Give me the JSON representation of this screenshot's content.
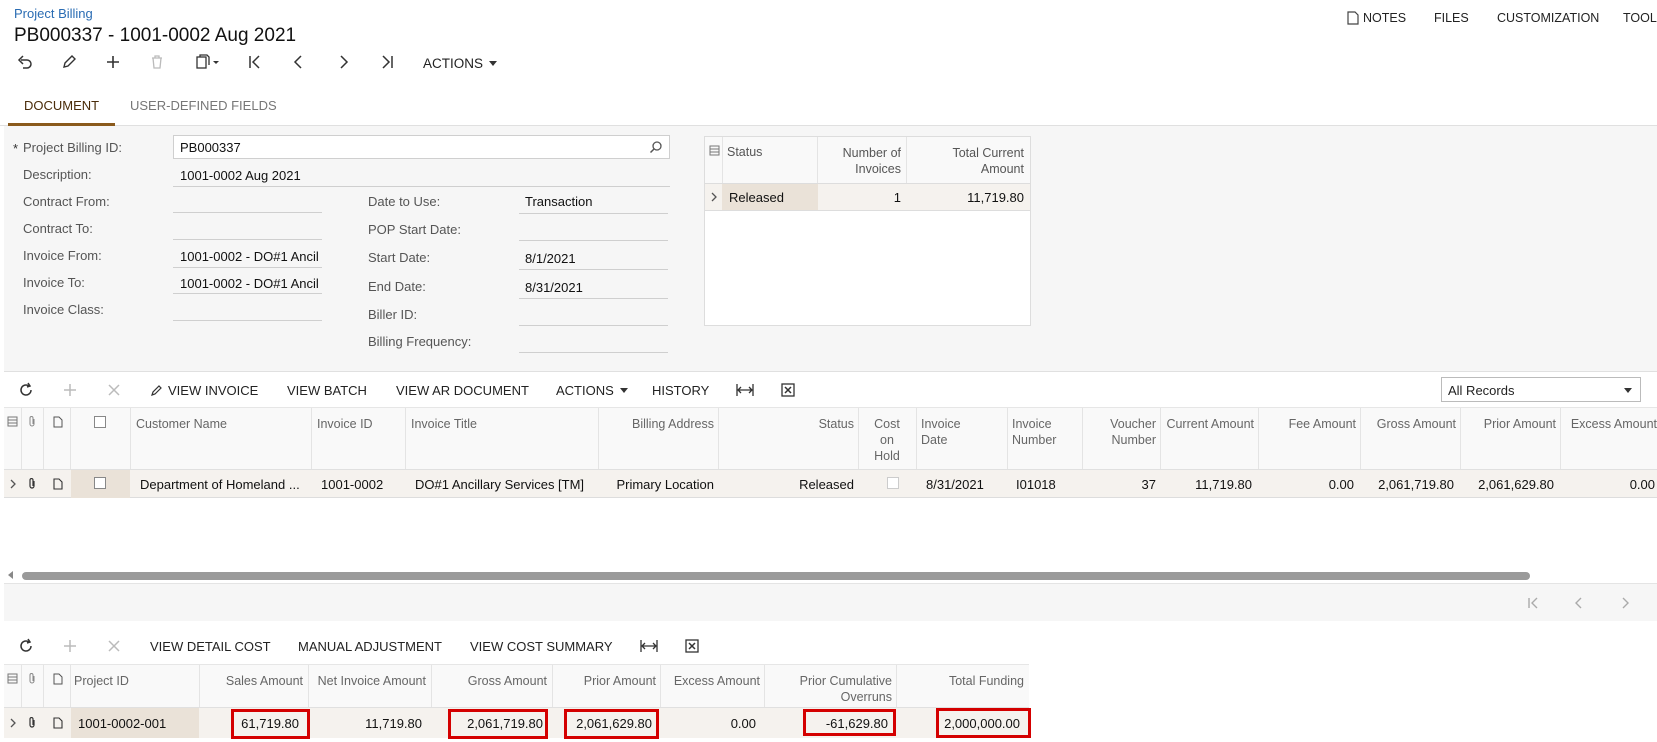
{
  "header": {
    "breadcrumb": "Project Billing",
    "title": "PB000337 - 1001-0002 Aug 2021",
    "right_menu": [
      "NOTES",
      "FILES",
      "CUSTOMIZATION",
      "TOOL"
    ],
    "actions_label": "ACTIONS"
  },
  "tabs": [
    "DOCUMENT",
    "USER-DEFINED FIELDS"
  ],
  "form": {
    "left": [
      {
        "label": "Project Billing ID:",
        "value": "PB000337"
      },
      {
        "label": "Description:",
        "value": "1001-0002 Aug 2021"
      },
      {
        "label": "Contract From:",
        "value": ""
      },
      {
        "label": "Contract To:",
        "value": ""
      },
      {
        "label": "Invoice From:",
        "value": "1001-0002 - DO#1 Ancil"
      },
      {
        "label": "Invoice To:",
        "value": "1001-0002 - DO#1 Ancil"
      },
      {
        "label": "Invoice Class:",
        "value": ""
      }
    ],
    "right": [
      {
        "label": "Date to Use:",
        "value": "Transaction"
      },
      {
        "label": "POP Start Date:",
        "value": ""
      },
      {
        "label": "Start Date:",
        "value": "8/1/2021"
      },
      {
        "label": "End Date:",
        "value": "8/31/2021"
      },
      {
        "label": "Biller ID:",
        "value": ""
      },
      {
        "label": "Billing Frequency:",
        "value": ""
      }
    ],
    "required_mark": "*"
  },
  "status_grid": {
    "headers": {
      "status": "Status",
      "num_invoices": "Number of Invoices",
      "total_current": "Total Current Amount"
    },
    "row": {
      "status": "Released",
      "num_invoices": "1",
      "total_current": "11,719.80"
    }
  },
  "invoice_toolbar": {
    "view_invoice": "VIEW INVOICE",
    "view_batch": "VIEW BATCH",
    "view_ar_document": "VIEW AR DOCUMENT",
    "actions": "ACTIONS",
    "history": "HISTORY",
    "filter": "All Records"
  },
  "invoice_grid": {
    "headers": {
      "customer_name": "Customer Name",
      "invoice_id": "Invoice ID",
      "invoice_title": "Invoice Title",
      "billing_address": "Billing Address",
      "status": "Status",
      "cost_on_hold": "Cost on Hold",
      "invoice_date": "Invoice Date",
      "invoice_number": "Invoice Number",
      "voucher_number": "Voucher Number",
      "current_amount": "Current Amount",
      "fee_amount": "Fee Amount",
      "gross_amount": "Gross Amount",
      "prior_amount": "Prior Amount",
      "excess_amount": "Excess Amount"
    },
    "row": {
      "customer_name": "Department of Homeland ...",
      "invoice_id": "1001-0002",
      "invoice_title": "DO#1 Ancillary Services [TM]",
      "billing_address": "Primary Location",
      "status": "Released",
      "invoice_date": "8/31/2021",
      "invoice_number": "I01018",
      "voucher_number": "37",
      "current_amount": "11,719.80",
      "fee_amount": "0.00",
      "gross_amount": "2,061,719.80",
      "prior_amount": "2,061,629.80",
      "excess_amount": "0.00"
    }
  },
  "detail_toolbar": {
    "view_detail_cost": "VIEW DETAIL COST",
    "manual_adjustment": "MANUAL ADJUSTMENT",
    "view_cost_summary": "VIEW COST SUMMARY"
  },
  "detail_grid": {
    "headers": {
      "project_id": "Project ID",
      "sales_amount": "Sales Amount",
      "net_invoice_amount": "Net Invoice Amount",
      "gross_amount": "Gross Amount",
      "prior_amount": "Prior Amount",
      "excess_amount": "Excess Amount",
      "prior_cumulative_overruns": "Prior Cumulative Overruns",
      "total_funding": "Total Funding"
    },
    "row": {
      "project_id": "1001-0002-001",
      "sales_amount": "61,719.80",
      "net_invoice_amount": "11,719.80",
      "gross_amount": "2,061,719.80",
      "prior_amount": "2,061,629.80",
      "excess_amount": "0.00",
      "prior_cumulative_overruns": "-61,629.80",
      "total_funding": "2,000,000.00"
    }
  },
  "colors": {
    "link": "#2a6cb3",
    "tab_accent": "#8a5a1c",
    "highlight": "#d40000"
  }
}
